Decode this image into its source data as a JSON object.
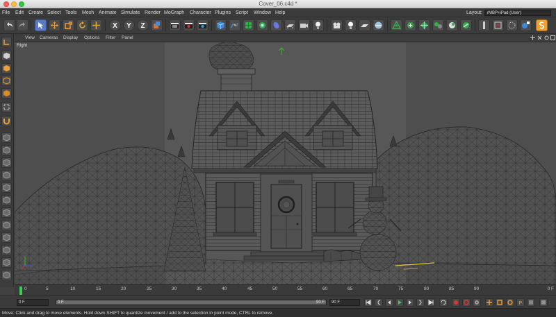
{
  "window": {
    "title": "Cover_06.c4d *"
  },
  "menu": {
    "items": [
      "File",
      "Edit",
      "Create",
      "Select",
      "Tools",
      "Mesh",
      "Animate",
      "Simulate",
      "Render",
      "MoGraph",
      "Character",
      "Plugins",
      "Script",
      "Window",
      "Help"
    ],
    "layout_label": "Layout:",
    "layout_value": "rMBP+iPad (User)"
  },
  "toolbar": {
    "icons": [
      "undo-icon",
      "redo-icon",
      "selection-tool-icon",
      "move-tool-icon",
      "scale-tool-icon",
      "rotate-tool-icon",
      "recent-tool-icon",
      "x-axis-lock-icon",
      "y-axis-lock-icon",
      "z-axis-lock-icon",
      "coordinate-system-icon",
      "render-view-icon",
      "render-picture-viewer-icon",
      "render-settings-icon",
      "cube-primitive-icon",
      "pen-spline-icon",
      "subdivision-surface-icon",
      "cloner-icon",
      "deformer-icon",
      "floor-environment-icon",
      "camera-icon",
      "light-icon",
      "scene-camera-icon",
      "light-object-icon",
      "sky-icon",
      "spline-tool-icon",
      "polygon-mode-icon",
      "snap-icon",
      "workplane-icon",
      "sculpt-icon",
      "texture-mode-icon",
      "model-mode-icon",
      "axis-mode-icon",
      "soft-select-icon",
      "paint-icon",
      "symmetry-icon",
      "snap-settings-icon"
    ],
    "axis_labels": [
      "X",
      "Y",
      "Z"
    ]
  },
  "viewport": {
    "menu": [
      "View",
      "Cameras",
      "Display",
      "Options",
      "Filter",
      "Panel"
    ],
    "view_name": "Right"
  },
  "timeline": {
    "ticks": [
      "0",
      "5",
      "10",
      "15",
      "20",
      "25",
      "30",
      "35",
      "40",
      "45",
      "50",
      "55",
      "60",
      "65",
      "70",
      "75",
      "80",
      "85",
      "90"
    ],
    "current_frame_label": "0 F"
  },
  "transport": {
    "start_field": "0 F",
    "range_start": "0 F",
    "range_end": "90 F",
    "end_field": "90 F",
    "range_fill": 1.0
  },
  "status": {
    "text": "Move: Click and drag to move elements. Hold down SHIFT to quantize movement / add to the selection in point mode, CTRL to remove."
  },
  "colors": {
    "accent": "#5a7bbf",
    "playhead": "#3bcf55",
    "axis_x": "#e03030",
    "axis_y": "#30c030",
    "axis_z": "#3060e0"
  }
}
